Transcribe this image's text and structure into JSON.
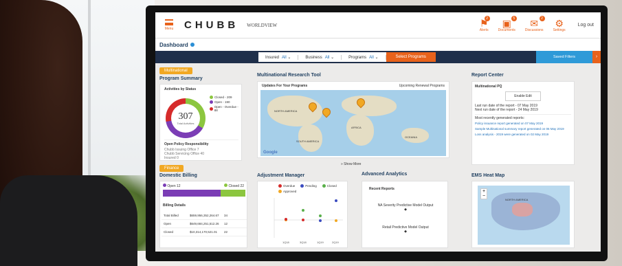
{
  "header": {
    "menu_label": "Menu",
    "logo": "CHUBB",
    "product": "WORLDVIEW",
    "icons": [
      {
        "name": "alerts",
        "label": "Alerts",
        "badge": "2",
        "glyph": "⚑"
      },
      {
        "name": "documents",
        "label": "Documents",
        "badge": "5",
        "glyph": "▣"
      },
      {
        "name": "discussions",
        "label": "Discussions",
        "badge": "2",
        "glyph": "✉"
      },
      {
        "name": "settings",
        "label": "Settings",
        "badge": "",
        "glyph": "⚙"
      }
    ],
    "logout": "Log out"
  },
  "title": "Dashboard",
  "filters": [
    {
      "label": "Insured",
      "value": "All"
    },
    {
      "label": "Business",
      "value": "All"
    },
    {
      "label": "Programs",
      "value": "All"
    }
  ],
  "select_programs": "Select Programs",
  "saved_filters": "Saved Filters",
  "multinational": {
    "tag": "Multinational",
    "program_summary": "Program Summary",
    "activities_title": "Activities by Status",
    "total": "307",
    "total_label": "Total Activities",
    "legend": [
      {
        "label": "Closed - 209",
        "color": "#8cc63f"
      },
      {
        "label": "Open - 190",
        "color": "#7b3db5"
      },
      {
        "label": "Open - Overdue - 88",
        "color": "#d62b2b"
      }
    ],
    "policy_title": "Open Policy Responsibility",
    "policy_items": [
      "Chubb Issuing Office 7",
      "Chubb Servicing Office 40",
      "Insured 0"
    ]
  },
  "research": {
    "title": "Multinational Research Tool",
    "subtitle": "Updates For Your Programs",
    "upcoming": "Upcoming Renewal Programs",
    "map_labels": [
      "NORTH AMERICA",
      "AFRICA",
      "SOUTH AMERICA",
      "OCEANIA"
    ],
    "google": "Google",
    "show_more": "Show More"
  },
  "report_center": {
    "title": "Report Center",
    "subtitle": "Multinational PQ",
    "button": "Enable Edit",
    "last_run": "Last run date of the report - 07 May 2019",
    "next_run": "Next run date of the report - 24 May 2019",
    "recent_title": "Most recently generated reports:",
    "links": [
      "Policy issuance report generated on 07 May 2019",
      "Sample Multinational summary report generated on 06 May 2019",
      "Loss analysis - 2019 were generated on 02 May 2019"
    ]
  },
  "finance": {
    "tag": "Finance",
    "title": "Domestic Billing",
    "open_label": "Open 12",
    "closed_label": "Closed 22",
    "details_title": "Billing Details",
    "rows": [
      {
        "label": "Total Billed",
        "amount": "$659,956,352,264.67",
        "count": "34"
      },
      {
        "label": "Open",
        "amount": "$649,684,251,512.26",
        "count": "12"
      },
      {
        "label": "Closed",
        "amount": "$10,314,170,521.01",
        "count": "22"
      }
    ]
  },
  "adjustment": {
    "title": "Adjustment Manager",
    "legend": [
      {
        "label": "Overdue",
        "color": "#d62b2b"
      },
      {
        "label": "Pending",
        "color": "#3b4cc0"
      },
      {
        "label": "Closed",
        "color": "#5ab04a"
      },
      {
        "label": "Approved",
        "color": "#f1a823"
      }
    ],
    "x_ticks": [
      "1Q18",
      "3Q18",
      "1Q19",
      "2Q19"
    ]
  },
  "analytics": {
    "title": "Advanced Analytics",
    "recent": "Recent Reports",
    "reports": [
      "NA Severity Predictive Model Output",
      "Retail Predictive Model Output"
    ]
  },
  "heatmap": {
    "title": "EMS Heat Map",
    "plus": "+",
    "minus": "−",
    "map_label": "NORTH AMERICA"
  }
}
